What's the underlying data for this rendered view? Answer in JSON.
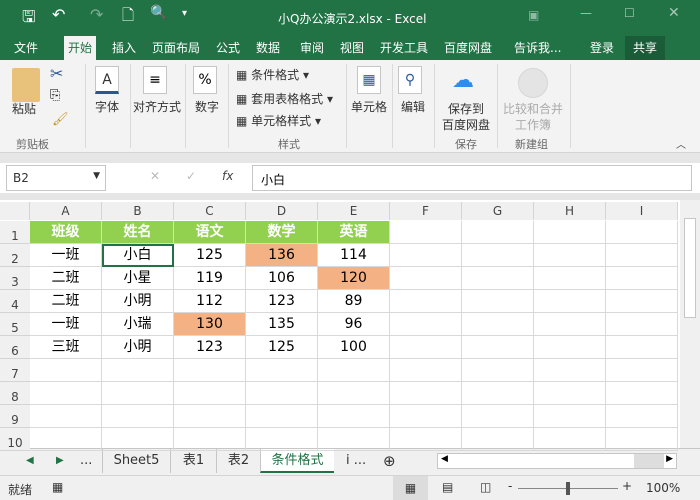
{
  "window": {
    "title": "小Q办公演示2.xlsx - Excel"
  },
  "ribbon_tabs": [
    {
      "label": "文件"
    },
    {
      "label": "开始"
    },
    {
      "label": "插入"
    },
    {
      "label": "页面布局"
    },
    {
      "label": "公式"
    },
    {
      "label": "数据"
    },
    {
      "label": "审阅"
    },
    {
      "label": "视图"
    },
    {
      "label": "开发工具"
    },
    {
      "label": "百度网盘"
    }
  ],
  "tellme": "告诉我...",
  "login": "登录",
  "share": "共享",
  "ribbon": {
    "paste": "粘贴",
    "clipboard": "剪贴板",
    "font": "字体",
    "align": "对齐方式",
    "number": "数字",
    "cond_format": "条件格式",
    "table_format": "套用表格格式",
    "cell_style": "单元格样式",
    "styles": "样式",
    "cells": "单元格",
    "edit": "编辑",
    "save_to": "保存到",
    "baidu": "百度网盘",
    "save": "保存",
    "compare1": "比较和合并",
    "compare2": "工作簿",
    "new_group": "新建组"
  },
  "formula": {
    "name_box": "B2",
    "fx": "fx",
    "value": "小白"
  },
  "columns": [
    "A",
    "B",
    "C",
    "D",
    "E",
    "F",
    "G",
    "H",
    "I"
  ],
  "rows": [
    "1",
    "2",
    "3",
    "4",
    "5",
    "6",
    "7",
    "8",
    "9",
    "10"
  ],
  "table": {
    "header": [
      "班级",
      "姓名",
      "语文",
      "数学",
      "英语"
    ],
    "data": [
      [
        "一班",
        "小白",
        "125",
        "136",
        "114"
      ],
      [
        "二班",
        "小星",
        "119",
        "106",
        "120"
      ],
      [
        "二班",
        "小明",
        "112",
        "123",
        "89"
      ],
      [
        "一班",
        "小瑞",
        "130",
        "135",
        "96"
      ],
      [
        "三班",
        "小明",
        "123",
        "125",
        "100"
      ]
    ],
    "highlights": [
      [
        0,
        3
      ],
      [
        1,
        4
      ],
      [
        3,
        2
      ]
    ]
  },
  "colors": {
    "accent": "#217346",
    "header_fill": "#92d050",
    "highlight_fill": "#f4b183"
  },
  "sheets": [
    {
      "label": "Sheet5"
    },
    {
      "label": "表1"
    },
    {
      "label": "表2"
    },
    {
      "label": "条件格式"
    }
  ],
  "sheet_more": "i ...",
  "ellipsis": "...",
  "status": {
    "ready": "就绪",
    "zoom": "100%"
  }
}
